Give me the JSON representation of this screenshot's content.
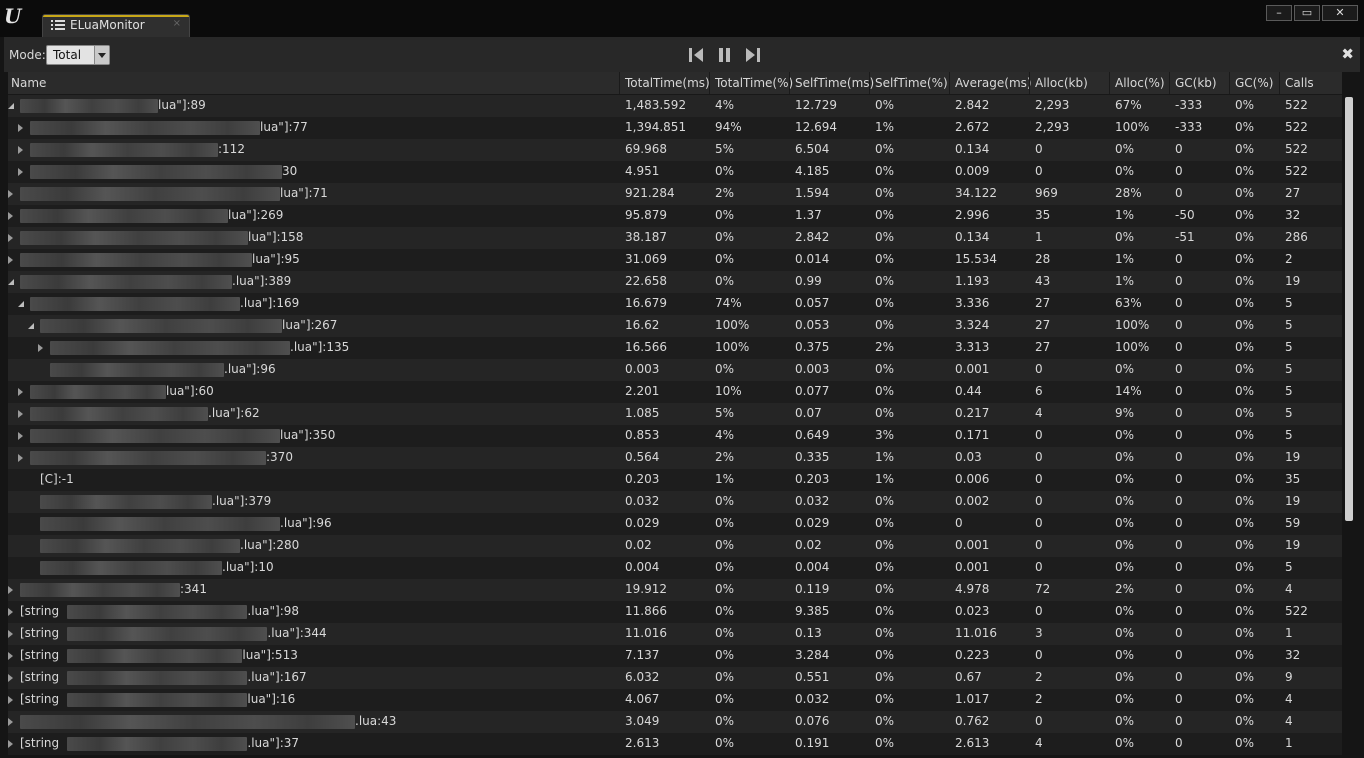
{
  "window": {
    "tab_title": "ELuaMonitor",
    "tab_close": "×",
    "controls": {
      "minimize": "–",
      "maximize": "▭",
      "close": "✕"
    }
  },
  "toolbar": {
    "mode_label": "Mode:",
    "mode_value": "Total",
    "panel_close": "✖"
  },
  "columns": [
    "Name",
    "TotalTime(ms)",
    "TotalTime(%)",
    "SelfTime(ms)",
    "SelfTime(%)",
    "Average(ms)",
    "Alloc(kb)",
    "Alloc(%)",
    "GC(kb)",
    "GC(%)",
    "Calls"
  ],
  "rows": [
    {
      "depth": 0,
      "expander": "expanded",
      "prefix": "",
      "suffix": "lua\"]:89",
      "values": [
        "1,483.592",
        "4%",
        "12.729",
        "0%",
        "2.842",
        "2,293",
        "67%",
        "-333",
        "0%",
        "522"
      ]
    },
    {
      "depth": 1,
      "expander": "collapsed",
      "prefix": "",
      "suffix": "lua\"]:77",
      "values": [
        "1,394.851",
        "94%",
        "12.694",
        "1%",
        "2.672",
        "2,293",
        "100%",
        "-333",
        "0%",
        "522"
      ]
    },
    {
      "depth": 1,
      "expander": "collapsed",
      "prefix": "",
      "suffix": ":112",
      "values": [
        "69.968",
        "5%",
        "6.504",
        "0%",
        "0.134",
        "0",
        "0%",
        "0",
        "0%",
        "522"
      ]
    },
    {
      "depth": 1,
      "expander": "collapsed",
      "prefix": "",
      "suffix": "30",
      "values": [
        "4.951",
        "0%",
        "4.185",
        "0%",
        "0.009",
        "0",
        "0%",
        "0",
        "0%",
        "522"
      ]
    },
    {
      "depth": 0,
      "expander": "collapsed",
      "prefix": "",
      "suffix": "lua\"]:71",
      "values": [
        "921.284",
        "2%",
        "1.594",
        "0%",
        "34.122",
        "969",
        "28%",
        "0",
        "0%",
        "27"
      ]
    },
    {
      "depth": 0,
      "expander": "collapsed",
      "prefix": "",
      "suffix": "lua\"]:269",
      "values": [
        "95.879",
        "0%",
        "1.37",
        "0%",
        "2.996",
        "35",
        "1%",
        "-50",
        "0%",
        "32"
      ]
    },
    {
      "depth": 0,
      "expander": "collapsed",
      "prefix": "",
      "suffix": "lua\"]:158",
      "values": [
        "38.187",
        "0%",
        "2.842",
        "0%",
        "0.134",
        "1",
        "0%",
        "-51",
        "0%",
        "286"
      ]
    },
    {
      "depth": 0,
      "expander": "collapsed",
      "prefix": "",
      "suffix": "lua\"]:95",
      "values": [
        "31.069",
        "0%",
        "0.014",
        "0%",
        "15.534",
        "28",
        "1%",
        "0",
        "0%",
        "2"
      ]
    },
    {
      "depth": 0,
      "expander": "expanded",
      "prefix": "",
      "suffix": ".lua\"]:389",
      "values": [
        "22.658",
        "0%",
        "0.99",
        "0%",
        "1.193",
        "43",
        "1%",
        "0",
        "0%",
        "19"
      ]
    },
    {
      "depth": 1,
      "expander": "expanded",
      "prefix": "",
      "suffix": ".lua\"]:169",
      "values": [
        "16.679",
        "74%",
        "0.057",
        "0%",
        "3.336",
        "27",
        "63%",
        "0",
        "0%",
        "5"
      ]
    },
    {
      "depth": 2,
      "expander": "expanded",
      "prefix": "",
      "suffix": "lua\"]:267",
      "values": [
        "16.62",
        "100%",
        "0.053",
        "0%",
        "3.324",
        "27",
        "100%",
        "0",
        "0%",
        "5"
      ]
    },
    {
      "depth": 3,
      "expander": "collapsed",
      "prefix": "",
      "suffix": ".lua\"]:135",
      "values": [
        "16.566",
        "100%",
        "0.375",
        "2%",
        "3.313",
        "27",
        "100%",
        "0",
        "0%",
        "5"
      ]
    },
    {
      "depth": 3,
      "expander": "none",
      "prefix": "",
      "suffix": ".lua\"]:96",
      "values": [
        "0.003",
        "0%",
        "0.003",
        "0%",
        "0.001",
        "0",
        "0%",
        "0",
        "0%",
        "5"
      ]
    },
    {
      "depth": 1,
      "expander": "collapsed",
      "prefix": "",
      "suffix": "lua\"]:60",
      "values": [
        "2.201",
        "10%",
        "0.077",
        "0%",
        "0.44",
        "6",
        "14%",
        "0",
        "0%",
        "5"
      ]
    },
    {
      "depth": 1,
      "expander": "collapsed",
      "prefix": "",
      "suffix": ".lua\"]:62",
      "values": [
        "1.085",
        "5%",
        "0.07",
        "0%",
        "0.217",
        "4",
        "9%",
        "0",
        "0%",
        "5"
      ]
    },
    {
      "depth": 1,
      "expander": "collapsed",
      "prefix": "",
      "suffix": "lua\"]:350",
      "values": [
        "0.853",
        "4%",
        "0.649",
        "3%",
        "0.171",
        "0",
        "0%",
        "0",
        "0%",
        "5"
      ]
    },
    {
      "depth": 1,
      "expander": "collapsed",
      "prefix": "",
      "suffix": ":370",
      "values": [
        "0.564",
        "2%",
        "0.335",
        "1%",
        "0.03",
        "0",
        "0%",
        "0",
        "0%",
        "19"
      ]
    },
    {
      "depth": 2,
      "expander": "none",
      "prefix": "[C]:-1",
      "suffix": "",
      "values": [
        "0.203",
        "1%",
        "0.203",
        "1%",
        "0.006",
        "0",
        "0%",
        "0",
        "0%",
        "35"
      ]
    },
    {
      "depth": 2,
      "expander": "none",
      "prefix": "",
      "suffix": ".lua\"]:379",
      "values": [
        "0.032",
        "0%",
        "0.032",
        "0%",
        "0.002",
        "0",
        "0%",
        "0",
        "0%",
        "19"
      ]
    },
    {
      "depth": 2,
      "expander": "none",
      "prefix": "",
      "suffix": ".lua\"]:96",
      "values": [
        "0.029",
        "0%",
        "0.029",
        "0%",
        "0",
        "0",
        "0%",
        "0",
        "0%",
        "59"
      ]
    },
    {
      "depth": 2,
      "expander": "none",
      "prefix": "",
      "suffix": ".lua\"]:280",
      "values": [
        "0.02",
        "0%",
        "0.02",
        "0%",
        "0.001",
        "0",
        "0%",
        "0",
        "0%",
        "19"
      ]
    },
    {
      "depth": 2,
      "expander": "none",
      "prefix": "",
      "suffix": ".lua\"]:10",
      "values": [
        "0.004",
        "0%",
        "0.004",
        "0%",
        "0.001",
        "0",
        "0%",
        "0",
        "0%",
        "5"
      ]
    },
    {
      "depth": 0,
      "expander": "collapsed",
      "prefix": "",
      "suffix": ":341",
      "values": [
        "19.912",
        "0%",
        "0.119",
        "0%",
        "4.978",
        "72",
        "2%",
        "0",
        "0%",
        "4"
      ]
    },
    {
      "depth": 0,
      "expander": "collapsed",
      "prefix": "[string",
      "suffix": ".lua\"]:98",
      "values": [
        "11.866",
        "0%",
        "9.385",
        "0%",
        "0.023",
        "0",
        "0%",
        "0",
        "0%",
        "522"
      ]
    },
    {
      "depth": 0,
      "expander": "collapsed",
      "prefix": "[string",
      "suffix": ".lua\"]:344",
      "values": [
        "11.016",
        "0%",
        "0.13",
        "0%",
        "11.016",
        "3",
        "0%",
        "0",
        "0%",
        "1"
      ]
    },
    {
      "depth": 0,
      "expander": "collapsed",
      "prefix": "[string",
      "suffix": "lua\"]:513",
      "values": [
        "7.137",
        "0%",
        "3.284",
        "0%",
        "0.223",
        "0",
        "0%",
        "0",
        "0%",
        "32"
      ]
    },
    {
      "depth": 0,
      "expander": "collapsed",
      "prefix": "[string",
      "suffix": ".lua\"]:167",
      "values": [
        "6.032",
        "0%",
        "0.551",
        "0%",
        "0.67",
        "2",
        "0%",
        "0",
        "0%",
        "9"
      ]
    },
    {
      "depth": 0,
      "expander": "collapsed",
      "prefix": "[string",
      "suffix": "lua\"]:16",
      "values": [
        "4.067",
        "0%",
        "0.032",
        "0%",
        "1.017",
        "2",
        "0%",
        "0",
        "0%",
        "4"
      ]
    },
    {
      "depth": 0,
      "expander": "collapsed",
      "prefix": "",
      "suffix": ".lua:43",
      "values": [
        "3.049",
        "0%",
        "0.076",
        "0%",
        "0.762",
        "0",
        "0%",
        "0",
        "0%",
        "4"
      ]
    },
    {
      "depth": 0,
      "expander": "collapsed",
      "prefix": "[string",
      "suffix": ".lua\"]:37",
      "values": [
        "2.613",
        "0%",
        "0.191",
        "0%",
        "2.613",
        "4",
        "0%",
        "0",
        "0%",
        "1"
      ]
    }
  ]
}
